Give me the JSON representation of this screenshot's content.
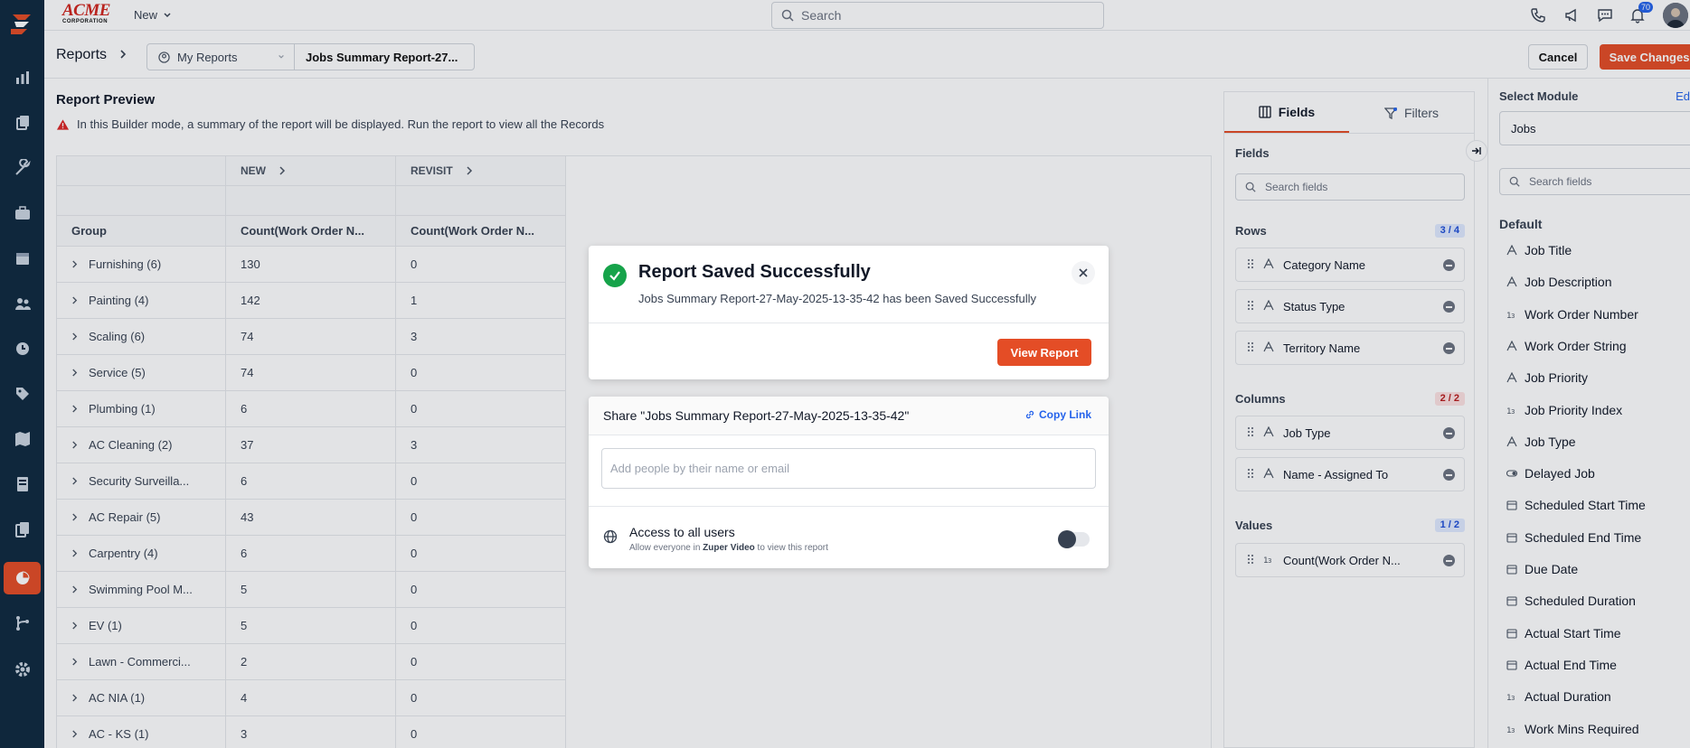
{
  "topbar": {
    "logo_main": "ACME",
    "logo_sub": "CORPORATION",
    "new_label": "New",
    "search_placeholder": "Search",
    "notification_count": "70"
  },
  "subbar": {
    "breadcrumb": "Reports",
    "folder": "My Reports",
    "report_name": "Jobs Summary Report-27...",
    "cancel_label": "Cancel",
    "save_label": "Save Changes"
  },
  "preview": {
    "title": "Report Preview",
    "warning": "In this Builder mode, a summary of the report will be displayed. Run the report to view all the Records",
    "col_groups": [
      "NEW",
      "REVISIT"
    ],
    "headers": [
      "Group",
      "Count(Work Order N...",
      "Count(Work Order N..."
    ],
    "rows": [
      {
        "group": "Furnishing (6)",
        "new": "130",
        "revisit": "0"
      },
      {
        "group": "Painting (4)",
        "new": "142",
        "revisit": "1"
      },
      {
        "group": "Scaling (6)",
        "new": "74",
        "revisit": "3"
      },
      {
        "group": "Service (5)",
        "new": "74",
        "revisit": "0"
      },
      {
        "group": "Plumbing (1)",
        "new": "6",
        "revisit": "0"
      },
      {
        "group": "AC Cleaning (2)",
        "new": "37",
        "revisit": "3"
      },
      {
        "group": "Security Surveilla...",
        "new": "6",
        "revisit": "0"
      },
      {
        "group": "AC Repair (5)",
        "new": "43",
        "revisit": "0"
      },
      {
        "group": "Carpentry (4)",
        "new": "6",
        "revisit": "0"
      },
      {
        "group": "Swimming Pool M...",
        "new": "5",
        "revisit": "0"
      },
      {
        "group": "EV (1)",
        "new": "5",
        "revisit": "0"
      },
      {
        "group": "Lawn - Commerci...",
        "new": "2",
        "revisit": "0"
      },
      {
        "group": "AC NIA (1)",
        "new": "4",
        "revisit": "0"
      },
      {
        "group": "AC - KS (1)",
        "new": "3",
        "revisit": "0"
      }
    ]
  },
  "fields_panel": {
    "tab_fields": "Fields",
    "tab_filters": "Filters",
    "fields_label": "Fields",
    "search_placeholder": "Search fields",
    "rows_label": "Rows",
    "rows_count": "3 / 4",
    "rows": [
      "Category Name",
      "Status Type",
      "Territory Name"
    ],
    "columns_label": "Columns",
    "columns_count": "2 / 2",
    "columns": [
      "Job Type",
      "Name - Assigned To"
    ],
    "values_label": "Values",
    "values_count": "1 / 2",
    "values": [
      "Count(Work Order N..."
    ]
  },
  "module_panel": {
    "label": "Select Module",
    "edit": "Ed",
    "selected": "Jobs",
    "search_placeholder": "Search fields",
    "default_label": "Default",
    "items": [
      {
        "label": "Job Title",
        "icon": "text"
      },
      {
        "label": "Job Description",
        "icon": "text"
      },
      {
        "label": "Work Order Number",
        "icon": "number"
      },
      {
        "label": "Work Order String",
        "icon": "text"
      },
      {
        "label": "Job Priority",
        "icon": "text"
      },
      {
        "label": "Job Priority Index",
        "icon": "number"
      },
      {
        "label": "Job Type",
        "icon": "text"
      },
      {
        "label": "Delayed Job",
        "icon": "toggle"
      },
      {
        "label": "Scheduled Start Time",
        "icon": "calendar"
      },
      {
        "label": "Scheduled End Time",
        "icon": "calendar"
      },
      {
        "label": "Due Date",
        "icon": "calendar"
      },
      {
        "label": "Scheduled Duration",
        "icon": "calendar"
      },
      {
        "label": "Actual Start Time",
        "icon": "calendar"
      },
      {
        "label": "Actual End Time",
        "icon": "calendar"
      },
      {
        "label": "Actual Duration",
        "icon": "number"
      },
      {
        "label": "Work Mins Required",
        "icon": "number"
      }
    ]
  },
  "modal_saved": {
    "title": "Report Saved Successfully",
    "message": "Jobs Summary Report-27-May-2025-13-35-42 has been Saved Successfully",
    "view_label": "View Report"
  },
  "modal_share": {
    "share_title": "Share \"Jobs Summary Report-27-May-2025-13-35-42\"",
    "copy_link": "Copy Link",
    "input_placeholder": "Add people by their name or email",
    "access_label": "Access to all users",
    "help_prefix": "Allow everyone in",
    "help_org": "Zuper Video",
    "help_suffix": "to view this report"
  },
  "colors": {
    "accent": "#e44d26",
    "sidebar": "#0f2a3f",
    "success": "#16a34a",
    "link": "#2563eb"
  }
}
